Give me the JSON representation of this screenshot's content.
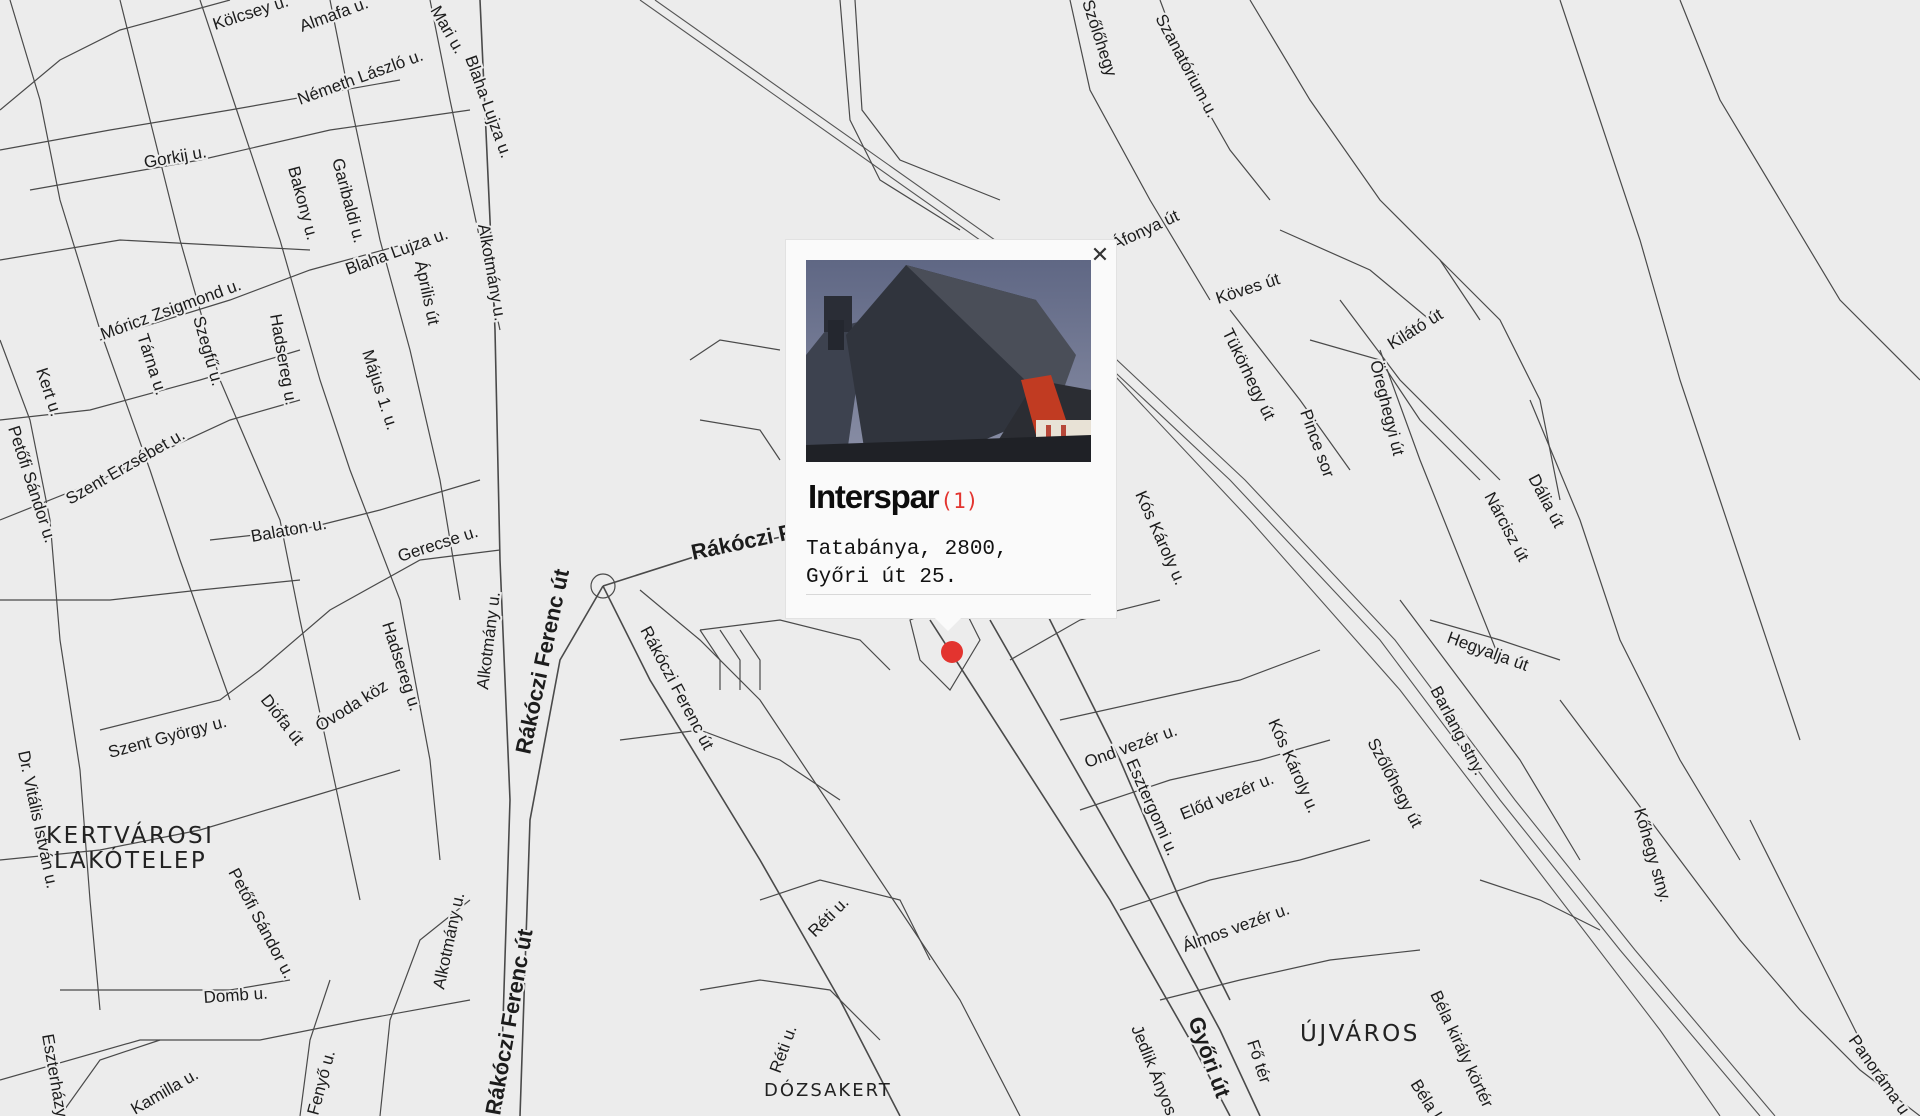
{
  "map": {
    "streets": [
      "Kölcsey u.",
      "Almafa u.",
      "Mari u.",
      "Németh László u.",
      "Blaha Lujza u.",
      "Gorkij u.",
      "Garibaldi u.",
      "Bakony u.",
      "Blaha Lujza u.",
      "Alkotmány u.",
      "Április út",
      "Móricz Zsigmond u.",
      "Tárna u.",
      "Szegfű u.",
      "Hadsereg u.",
      "Május 1. u.",
      "Kert u.",
      "Petőfi Sándor u.",
      "Szent Erzsébet u.",
      "Balaton u.",
      "Gerecse u.",
      "Alkotmány u.",
      "Rákóczi Ferenc út",
      "Rákóczi Fe",
      "Hadsereg u.",
      "Óvoda köz",
      "Diófa út",
      "Szent György u.",
      "Dr. Vitális István u.",
      "Petőfi Sándor u.",
      "Alkotmány u.",
      "Rákóczi Ferenc út",
      "Rákóczi Ferenc út",
      "Domb u.",
      "Réti u.",
      "Réti u.",
      "Kamilla u.",
      "Eszterházy u.",
      "Fenyő u.",
      "Szőlőhegy",
      "Szanatórium u.",
      "Áfonya út",
      "Köves út",
      "Tükörhegy út",
      "Kilátó út",
      "Öreghegyi út",
      "Pince sor",
      "Kós Károly u.",
      "Dália út",
      "Nárcisz út",
      "Hegyalja út",
      "Barlang stny.",
      "Szőlőhegy út",
      "Ond vezér u.",
      "Esztergomi u.",
      "Előd vezér u.",
      "Kós Károly u.",
      "Kőhegy stny.",
      "Álmos vezér u.",
      "Jedlik Ányos",
      "Győri út",
      "Fő tér",
      "Béla király körtér",
      "Béla k",
      "Panoráma u.",
      "u."
    ],
    "districts": [
      "KERTVÁROSI",
      "LAKÓTELEP",
      "ÚJVÁROS",
      "DÓZSAKERT"
    ]
  },
  "popup": {
    "close_icon": "close-icon",
    "photo_alt": "Interspar",
    "brand": "Interspar",
    "count": "(1)",
    "address": "Tatabánya, 2800,\nGyőri út 25."
  },
  "marker": {
    "icon": "location-marker-icon",
    "color": "#e3342f"
  },
  "colors": {
    "background": "#ececec",
    "road": "#4a4a4a",
    "accent": "#e3342f"
  }
}
